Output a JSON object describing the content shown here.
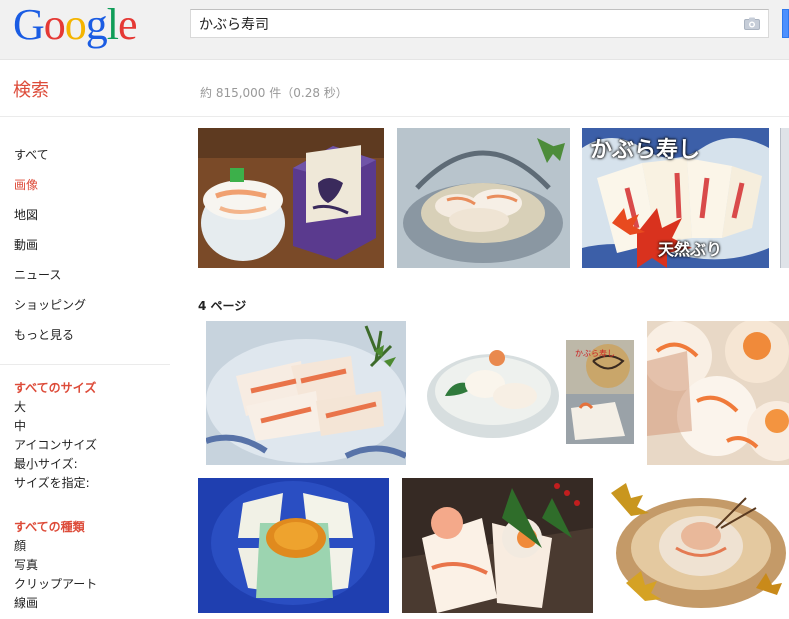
{
  "header": {
    "logo_letters": [
      "G",
      "o",
      "o",
      "g",
      "l",
      "e"
    ],
    "logo_colors": [
      "#1a5ce3",
      "#e53935",
      "#f4b400",
      "#1a5ce3",
      "#0f9d58",
      "#e53935"
    ],
    "query": "かぶら寿司",
    "camera_icon": "camera-icon"
  },
  "subheader": {
    "search_label": "検索",
    "result_stats": "約 815,000 件（0.28 秒）"
  },
  "sidebar": {
    "nav": [
      "すべて",
      "画像",
      "地図",
      "動画",
      "ニュース",
      "ショッピング",
      "もっと見る"
    ],
    "active_index": 1,
    "size_filter": {
      "title": "すべてのサイズ",
      "items": [
        "大",
        "中",
        "アイコンサイズ",
        "最小サイズ:",
        "サイズを指定:"
      ]
    },
    "type_filter": {
      "title": "すべての種類",
      "items": [
        "顔",
        "写真",
        "クリップアート",
        "線画"
      ]
    }
  },
  "results": {
    "page_label": "4 ページ",
    "thumb3_caption_top": "かぶら寿し",
    "thumb3_caption_bottom": "天然ぶり",
    "thumb5_label": "かぶら寿し"
  },
  "colors": {
    "accent_red": "#dd4b39",
    "search_blue": "#4d90fe"
  }
}
